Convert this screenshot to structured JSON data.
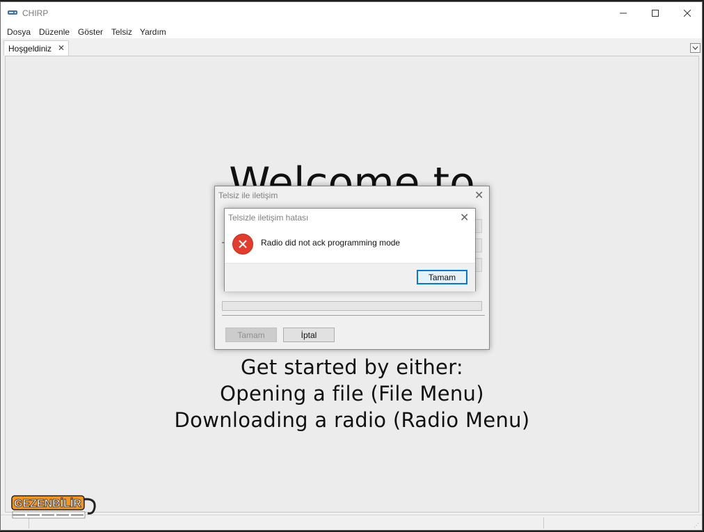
{
  "window": {
    "title": "CHIRP"
  },
  "menubar": {
    "items": [
      "Dosya",
      "Düzenle",
      "Göster",
      "Telsiz",
      "Yardım"
    ]
  },
  "tabs": [
    {
      "label": "Hoşgeldiniz",
      "close": "✕"
    }
  ],
  "welcome": {
    "title": "Welcome to",
    "lines": [
      "Get started by either:",
      "Opening a file (File Menu)",
      "Downloading a radio (Radio Menu)"
    ]
  },
  "progress_dialog": {
    "title": "Telsiz ile iletişim",
    "partial_label": "T",
    "progress": 0,
    "ok_label": "Tamam",
    "cancel_label": "İptal"
  },
  "error_dialog": {
    "title": "Telsizle iletişim hatası",
    "message": "Radio did not ack programming mode",
    "ok_label": "Tamam",
    "icon": "error-icon"
  },
  "watermark": {
    "text": "GEZENBİLİR"
  },
  "colors": {
    "accent": "#0078d7",
    "error": "#e23c2c",
    "window_bg": "#f0f0f0"
  }
}
